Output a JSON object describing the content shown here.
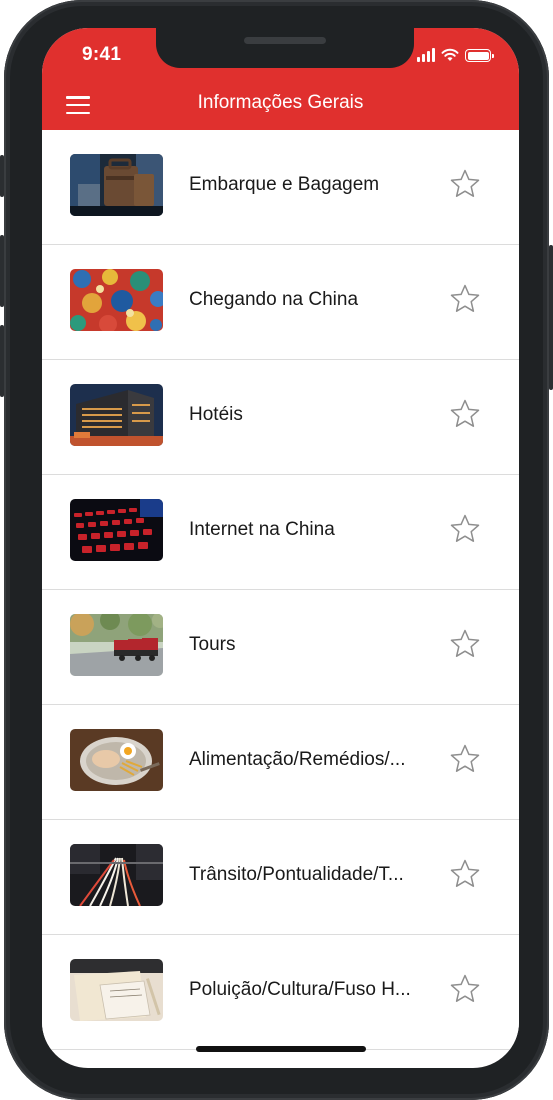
{
  "status_bar": {
    "time": "9:41"
  },
  "header": {
    "title": "Informações Gerais",
    "menu_icon": "hamburger-menu-icon",
    "color": "#e0302e"
  },
  "items": [
    {
      "label": "Embarque e Bagagem",
      "thumbnail": "luggage"
    },
    {
      "label": "Chegando na China",
      "thumbnail": "dragon-pattern"
    },
    {
      "label": "Hotéis",
      "thumbnail": "hotel-building"
    },
    {
      "label": "Internet na China",
      "thumbnail": "keyboard"
    },
    {
      "label": "Tours",
      "thumbnail": "street-rickshaws"
    },
    {
      "label": "Alimentação/Remédios/...",
      "thumbnail": "food-bowl"
    },
    {
      "label": "Trânsito/Pontualidade/T...",
      "thumbnail": "traffic-lights"
    },
    {
      "label": "Poluição/Cultura/Fuso H...",
      "thumbnail": "notes-paper"
    }
  ],
  "favorite_icon": "star-outline-icon"
}
